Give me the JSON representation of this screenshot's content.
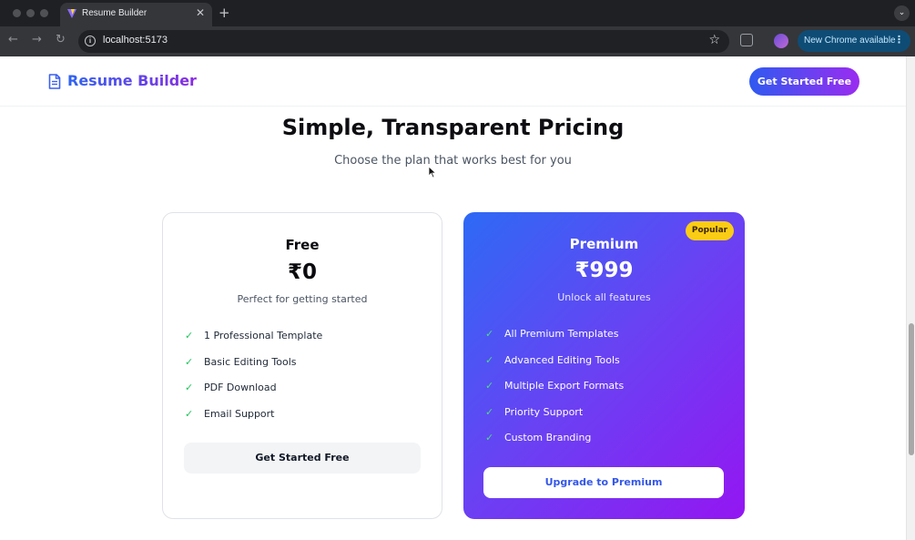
{
  "browser": {
    "tab_title": "Resume Builder",
    "tab_close": "✕",
    "new_tab": "+",
    "url": "localhost:5173",
    "new_chrome_label": "New Chrome available",
    "menu_dots": "⋮",
    "icons": {
      "back": "←",
      "forward": "→",
      "reload": "↻",
      "info": "i",
      "star": "☆",
      "tab_menu": "⌄"
    }
  },
  "site": {
    "logo_text": "Resume Builder",
    "nav_cta": "Get Started Free"
  },
  "pricing": {
    "title": "Simple, Transparent Pricing",
    "subtitle": "Choose the plan that works best for you"
  },
  "plans": {
    "free": {
      "name": "Free",
      "price": "₹0",
      "description": "Perfect for getting started",
      "features": [
        "1 Professional Template",
        "Basic Editing Tools",
        "PDF Download",
        "Email Support"
      ],
      "button": "Get Started Free"
    },
    "premium": {
      "badge": "Popular",
      "name": "Premium",
      "price": "₹999",
      "description": "Unlock all features",
      "features": [
        "All Premium Templates",
        "Advanced Editing Tools",
        "Multiple Export Formats",
        "Priority Support",
        "Custom Branding"
      ],
      "button": "Upgrade to Premium"
    }
  },
  "check_glyph": "✓",
  "colors": {
    "brand_blue": "#2f64f0",
    "brand_purple": "#9416f2",
    "check_green": "#22c55e",
    "badge_yellow": "#facc15"
  }
}
